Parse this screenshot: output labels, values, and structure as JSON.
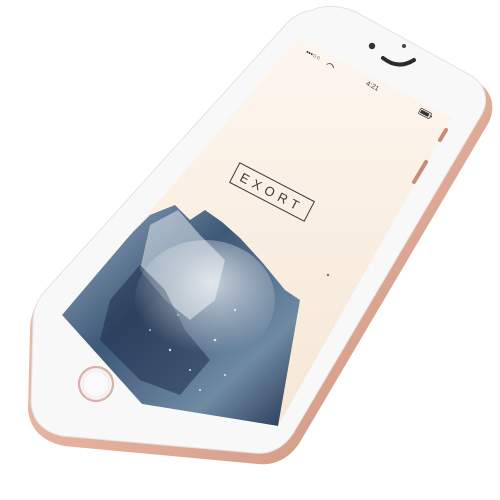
{
  "device": {
    "model": "iPhone",
    "finish": "rose gold",
    "colors": {
      "frame": "#e8b9a6",
      "frame_shadow": "#c98d78",
      "bezel": "#f7f7f7",
      "screen_bg": "#fbf2e8",
      "mountain_dark": "#2c3f5a",
      "mountain_light": "#cfdbe3"
    }
  },
  "status_bar": {
    "carrier_signal": "•••○○",
    "time": "",
    "time_display": "4:21",
    "battery_percent": ""
  },
  "app": {
    "logo_text": "EXORT"
  },
  "icons": {
    "front_camera": "camera-icon",
    "earpiece": "speaker-icon",
    "home_button": "home-button-icon",
    "battery": "battery-icon",
    "signal": "signal-icon",
    "wifi": "wifi-icon"
  }
}
